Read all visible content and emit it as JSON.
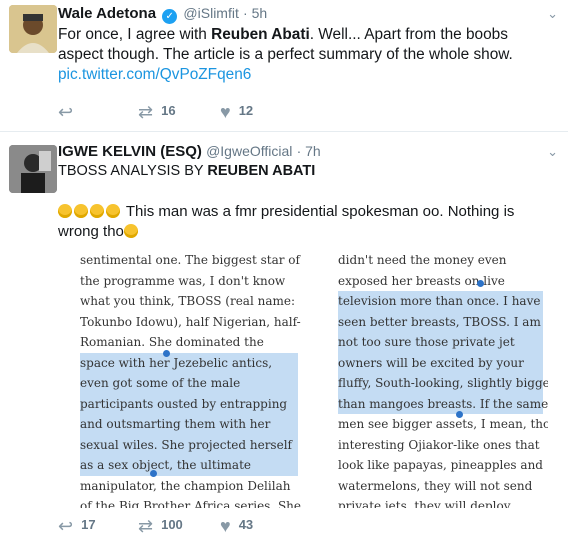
{
  "tweets": [
    {
      "name": "Wale Adetona",
      "handle": "@iSlimfit",
      "time": "· 5h",
      "verified": true,
      "text": "For once, I agree with ",
      "text_bold": "Reuben Abati",
      "text_rest": ". Well... Apart from the boobs aspect though. The article is a perfect summary of the whole show.",
      "link": "pic.twitter.com/QvPoZFqen6",
      "actions": {
        "reply": "",
        "retweet": "16",
        "like": "12"
      }
    },
    {
      "name": "IGWE KELVIN (ESQ)",
      "handle": "@IgweOfficial",
      "time": "· 7h",
      "text_line1_pre": "TBOSS ANALYSIS BY ",
      "text_line1_bold": "REUBEN ABATI",
      "text_line2": " This man was a fmr presidential spokesman oo. Nothing is wrong tho",
      "actions": {
        "reply": "17",
        "retweet": "100",
        "like": "43"
      }
    }
  ],
  "media": {
    "col1": [
      "sentimental one. The biggest star of",
      "the programme was, I don't know",
      "what you think, TBOSS (real name:",
      "Tokunbo Idowu), half Nigerian, half-",
      "Romanian. She dominated the",
      "space with her Jezebelic antics,",
      "even got some of the male",
      "participants ousted by entrapping",
      "and outsmarting them with her",
      "sexual wiles. She projected herself",
      "as a sex object, the ultimate",
      "manipulator, the champion Delilah",
      "of the Big Brother Africa series. She"
    ],
    "col2": [
      "didn't need the money even",
      "exposed her breasts on live",
      "television more than once. I have",
      "seen better breasts, TBOSS. I am",
      "not too sure those private jet",
      "owners will be excited by your",
      "fluffy, South-looking, slightly bigger",
      "than mangoes breasts. If the same",
      "men see bigger assets, I mean, those",
      "interesting Ojiakor-like ones that",
      "look like papayas, pineapples and",
      "watermelons, they will not send",
      "private jets, they will deploy"
    ]
  }
}
